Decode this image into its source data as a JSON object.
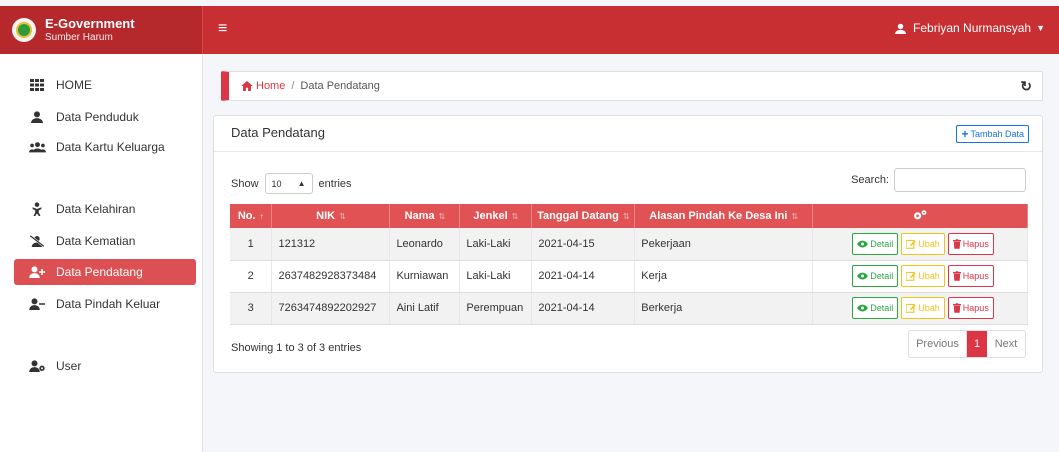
{
  "brand": {
    "title": "E-Government",
    "subtitle": "Sumber Harum"
  },
  "user": {
    "name": "Febriyan Nurmansyah"
  },
  "sidebar": {
    "items": [
      {
        "label": "HOME",
        "icon": "grid-icon"
      },
      {
        "label": "Data Penduduk",
        "icon": "user-icon"
      },
      {
        "label": "Data Kartu Keluarga",
        "icon": "users-icon"
      },
      {
        "label": "Data Kelahiran",
        "icon": "baby-icon"
      },
      {
        "label": "Data Kematian",
        "icon": "user-slash-icon"
      },
      {
        "label": "Data Pendatang",
        "icon": "user-plus-icon",
        "active": true
      },
      {
        "label": "Data Pindah Keluar",
        "icon": "user-minus-icon"
      },
      {
        "label": "User",
        "icon": "user-cog-icon"
      }
    ]
  },
  "breadcrumb": {
    "home": "Home",
    "separator": "/",
    "current": "Data Pendatang"
  },
  "card": {
    "title": "Data Pendatang",
    "add_label": "Tambah Data"
  },
  "table_controls": {
    "show_label": "Show",
    "entries_value": "10",
    "entries_label": "entries",
    "search_label": "Search:"
  },
  "table": {
    "headers": [
      "No.",
      "NIK",
      "Nama",
      "Jenkel",
      "Tanggal Datang",
      "Alasan Pindah Ke Desa Ini"
    ],
    "rows": [
      [
        "1",
        "121312",
        "Leonardo",
        "Laki-Laki",
        "2021-04-15",
        "Pekerjaan"
      ],
      [
        "2",
        "2637482928373484",
        "Kurniawan",
        "Laki-Laki",
        "2021-04-14",
        "Kerja"
      ],
      [
        "3",
        "7263474892202927",
        "Aini Latif",
        "Perempuan",
        "2021-04-14",
        "Berkerja"
      ]
    ],
    "actions": {
      "detail": "Detail",
      "ubah": "Ubah",
      "hapus": "Hapus"
    }
  },
  "footer": {
    "showing": "Showing 1 to 3 of 3 entries",
    "prev": "Previous",
    "page": "1",
    "next": "Next"
  },
  "colors": {
    "primary": "#c72f32",
    "accent": "#dc3545",
    "success": "#28a745",
    "warning": "#f0c419",
    "link": "#1a73e8"
  }
}
